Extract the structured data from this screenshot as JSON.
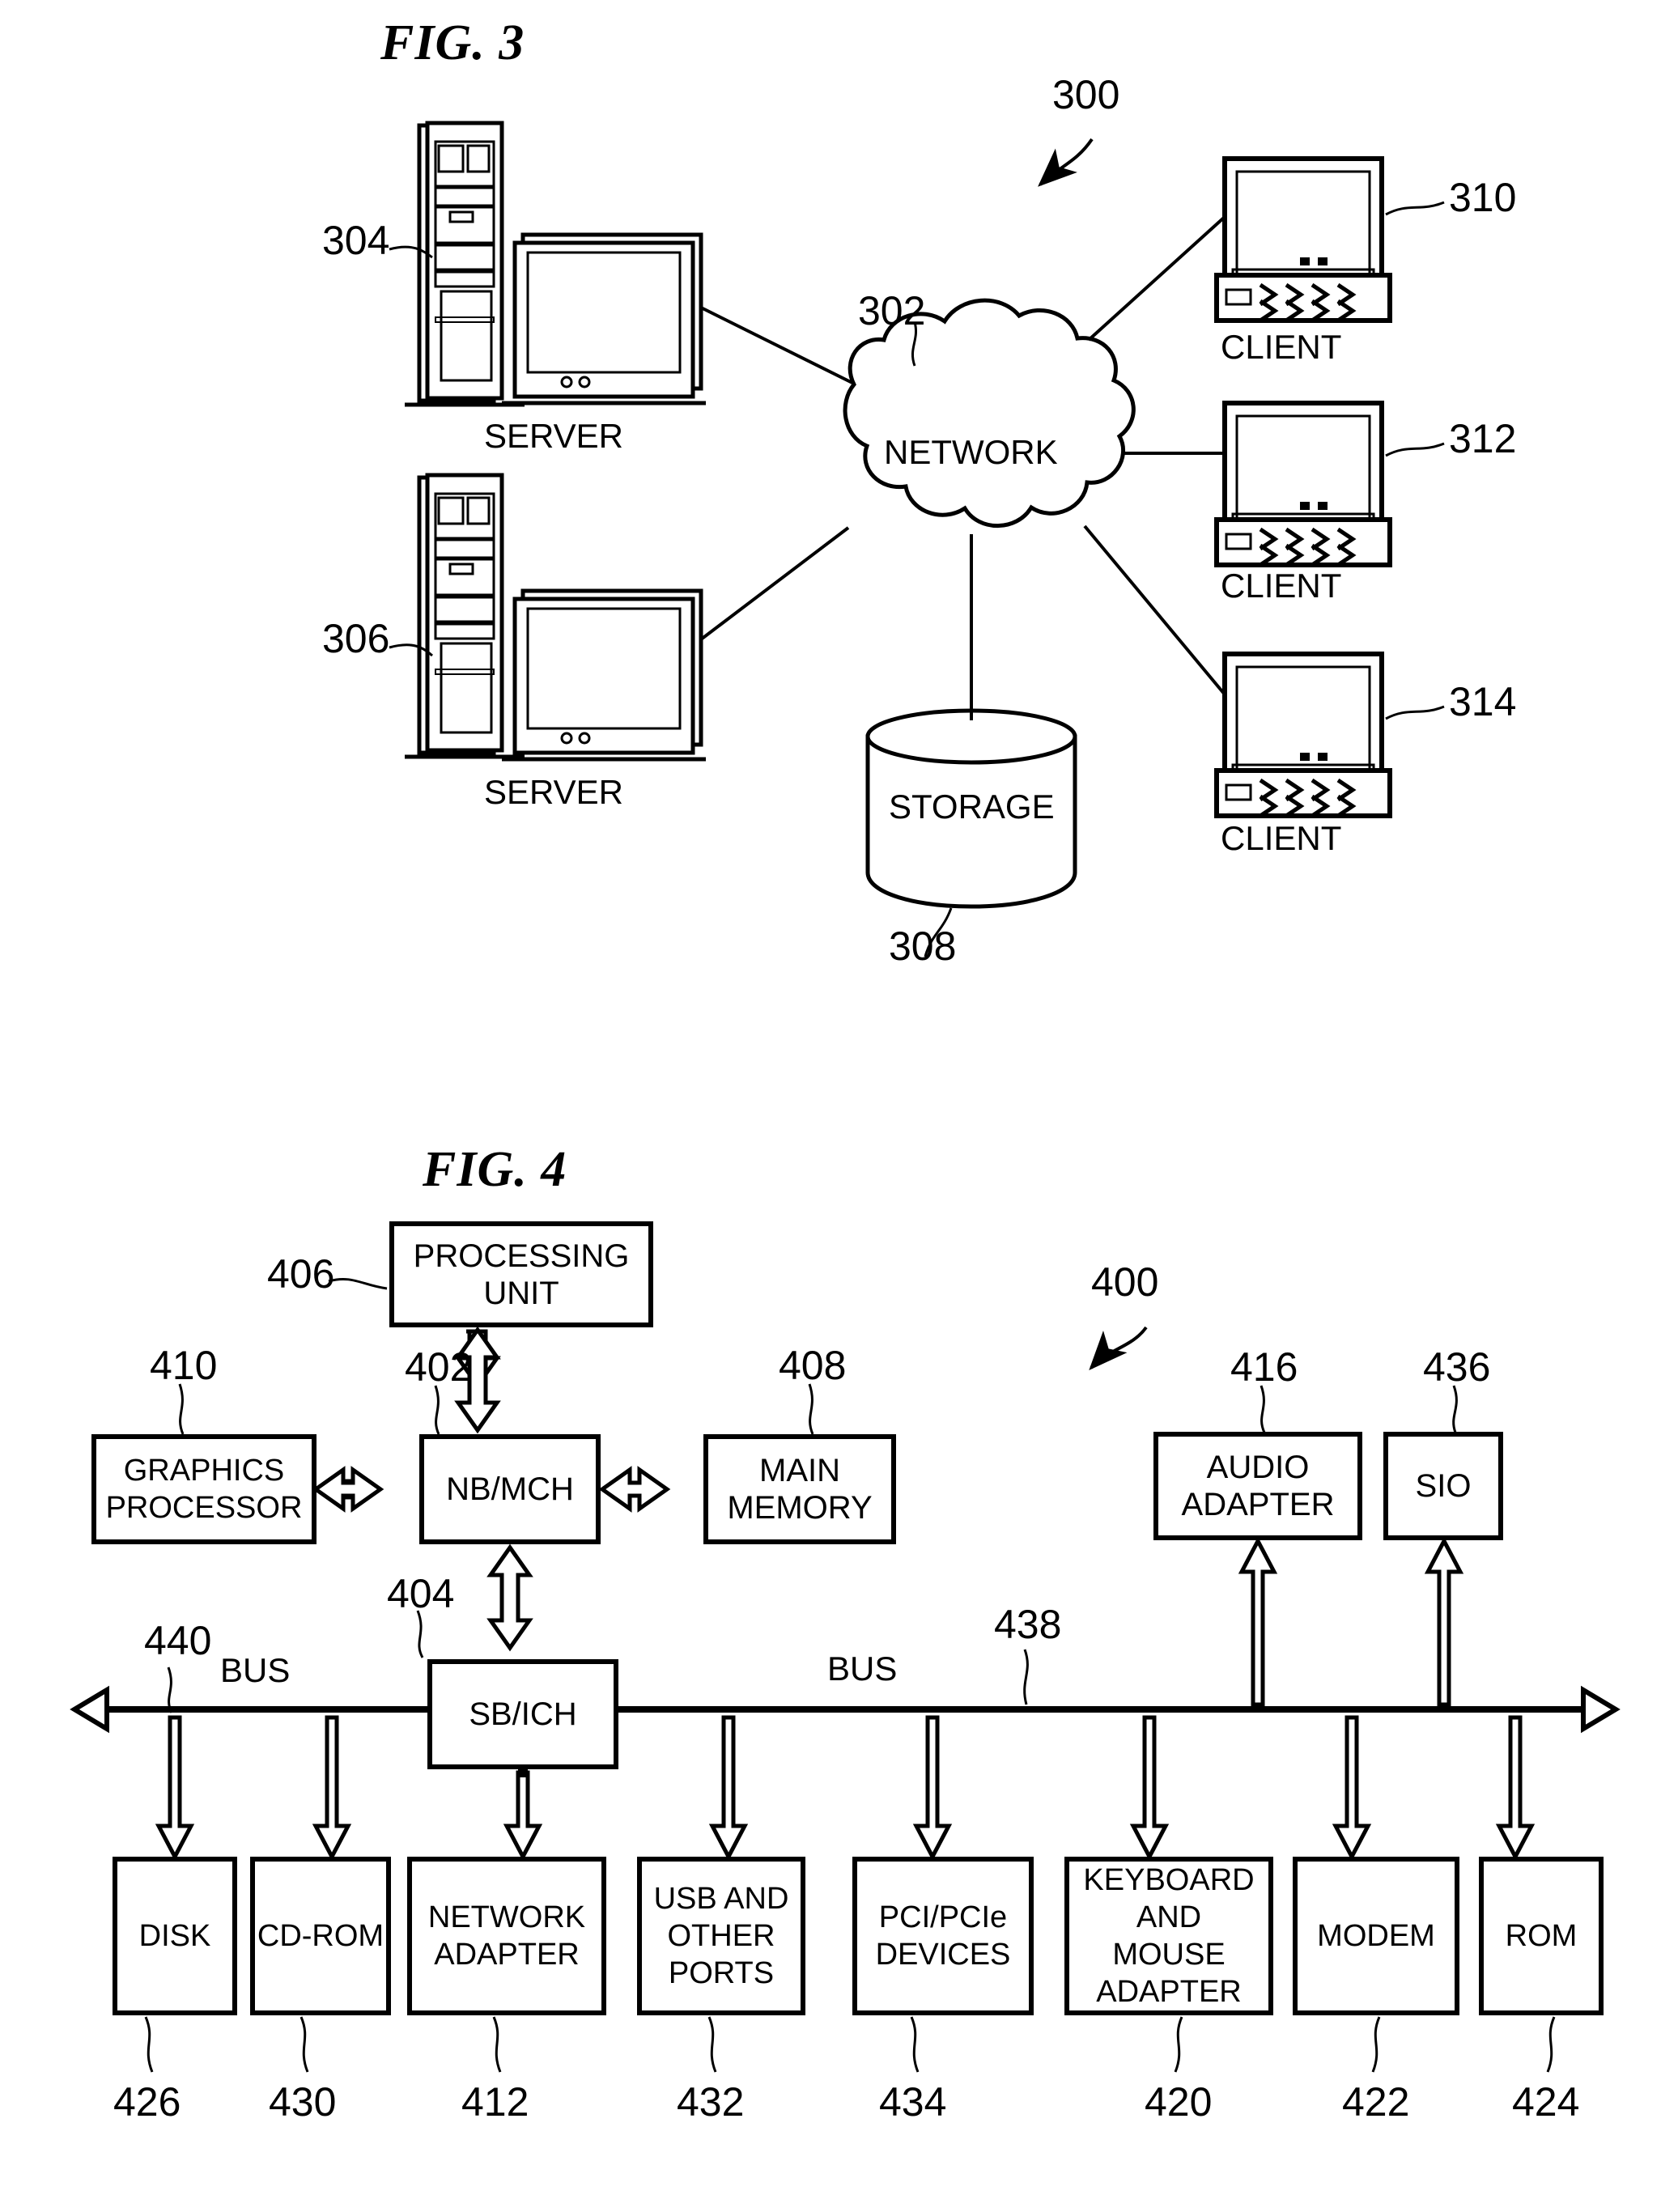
{
  "figures": [
    {
      "id": "fig3",
      "title": "FIG. 3",
      "system_ref": "300",
      "nodes": {
        "network": {
          "label": "NETWORK",
          "ref": "302"
        },
        "storage": {
          "label": "STORAGE",
          "ref": "308"
        },
        "server_top": {
          "label": "SERVER",
          "ref": "304"
        },
        "server_bottom": {
          "label": "SERVER",
          "ref": "306"
        },
        "client_top": {
          "label": "CLIENT",
          "ref": "310"
        },
        "client_mid": {
          "label": "CLIENT",
          "ref": "312"
        },
        "client_bottom": {
          "label": "CLIENT",
          "ref": "314"
        }
      }
    },
    {
      "id": "fig4",
      "title": "FIG. 4",
      "system_ref": "400",
      "bus_label_left": "BUS",
      "bus_label_right": "BUS",
      "bus_ref_left": "440",
      "bus_ref_right": "438",
      "blocks": [
        {
          "key": "processing_unit",
          "label": "PROCESSING\nUNIT",
          "ref": "406"
        },
        {
          "key": "graphics_processor",
          "label": "GRAPHICS\nPROCESSOR",
          "ref": "410"
        },
        {
          "key": "nb_mch",
          "label": "NB/MCH",
          "ref": "402"
        },
        {
          "key": "main_memory",
          "label": "MAIN\nMEMORY",
          "ref": "408"
        },
        {
          "key": "audio_adapter",
          "label": "AUDIO\nADAPTER",
          "ref": "416"
        },
        {
          "key": "sio",
          "label": "SIO",
          "ref": "436"
        },
        {
          "key": "sb_ich",
          "label": "SB/ICH",
          "ref": "404"
        },
        {
          "key": "disk",
          "label": "DISK",
          "ref": "426"
        },
        {
          "key": "cdrom",
          "label": "CD-ROM",
          "ref": "430"
        },
        {
          "key": "network_adapter",
          "label": "NETWORK\nADAPTER",
          "ref": "412"
        },
        {
          "key": "usb_ports",
          "label": "USB AND\nOTHER\nPORTS",
          "ref": "432"
        },
        {
          "key": "pci_devices",
          "label": "PCI/PCIe\nDEVICES",
          "ref": "434"
        },
        {
          "key": "keyboard_mouse",
          "label": "KEYBOARD\nAND\nMOUSE\nADAPTER",
          "ref": "420"
        },
        {
          "key": "modem",
          "label": "MODEM",
          "ref": "422"
        },
        {
          "key": "rom",
          "label": "ROM",
          "ref": "424"
        }
      ]
    }
  ],
  "colors": {
    "ink": "#000000",
    "paper": "#ffffff"
  }
}
